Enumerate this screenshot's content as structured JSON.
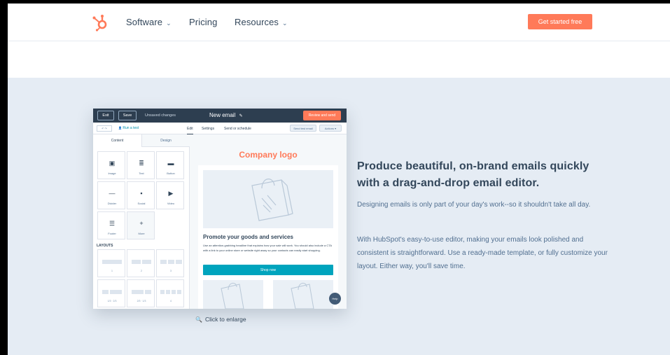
{
  "nav": {
    "items": [
      {
        "label": "Software",
        "has_dropdown": true
      },
      {
        "label": "Pricing",
        "has_dropdown": false
      },
      {
        "label": "Resources",
        "has_dropdown": true
      }
    ],
    "cta_label": "Get started free",
    "logo_icon": "hubspot-sprocket-icon",
    "chevron_glyph": "⌄"
  },
  "editor": {
    "top_bar": {
      "exit_label": "Exit",
      "save_label": "Save",
      "status": "Unsaved changes",
      "title": "New email",
      "edit_glyph": "✎",
      "review_label": "Review and send"
    },
    "sub_bar": {
      "undo_label": "↶ ↷",
      "run_test": "Run a test",
      "person_glyph": "👤",
      "tabs": [
        "Edit",
        "Settings",
        "Send or schedule"
      ],
      "send_test": "Send test email",
      "actions": "Actions ▾"
    },
    "left_tabs": [
      "Content",
      "Design"
    ],
    "modules": [
      {
        "label": "Image",
        "glyph": "▣"
      },
      {
        "label": "Text",
        "glyph": "≣"
      },
      {
        "label": "Button",
        "glyph": "▬"
      },
      {
        "label": "Divider",
        "glyph": "—"
      },
      {
        "label": "Social",
        "glyph": "▪"
      },
      {
        "label": "Video",
        "glyph": "▶"
      },
      {
        "label": "Footer",
        "glyph": "☰"
      },
      {
        "label": "More",
        "glyph": "+"
      }
    ],
    "layouts_label": "LAYOUTS",
    "layouts": [
      "1",
      "2",
      "3",
      "1/3 · 2/3",
      "2/3 · 1/3",
      "4"
    ],
    "canvas": {
      "logo_text": "Company logo",
      "headline": "Promote your goods and services",
      "body": "Use an attention-grabbing headline that explains how your sale will work. You should also include a CTA with a link to your online store or website right away so your contacts can easily start shopping.",
      "button": "Shop now"
    },
    "help_label": "Help"
  },
  "enlarge": {
    "label": "Click to enlarge",
    "glyph": "🔍"
  },
  "copy": {
    "heading": "Produce beautiful, on-brand emails quickly with a drag-and-drop email editor.",
    "p1": "Designing emails is only part of your day's work--so it shouldn't take all day.",
    "p2": "With HubSpot's easy-to-use editor, making your emails look polished and consistent is straightforward. Use a ready-made template, or fully customize your layout. Either way, you'll save time."
  },
  "colors": {
    "accent": "#ff7a59",
    "teal": "#00a4bd",
    "navy": "#2d3e50",
    "section_bg": "#e5ecf4",
    "text": "#33475b"
  }
}
